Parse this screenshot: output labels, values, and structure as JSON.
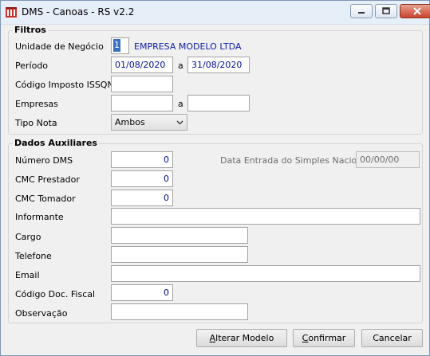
{
  "window": {
    "title": "DMS - Canoas - RS v2.2"
  },
  "filtros": {
    "legend": "Filtros",
    "unidade_label": "Unidade de Negócio",
    "unidade_value": "1",
    "unidade_name": "EMPRESA MODELO LTDA",
    "periodo_label": "Período",
    "periodo_from": "01/08/2020",
    "periodo_sep": "a",
    "periodo_to": "31/08/2020",
    "codigo_label": "Código Imposto ISSQN",
    "codigo_value": "",
    "empresas_label": "Empresas",
    "empresas_from": "",
    "empresas_sep": "a",
    "empresas_to": "",
    "tipo_label": "Tipo Nota",
    "tipo_value": "Ambos"
  },
  "auxiliares": {
    "legend": "Dados Auxiliares",
    "numero_label": "Número DMS",
    "numero_value": "0",
    "data_entrada_label": "Data Entrada do Simples Nacional",
    "data_entrada_value": "00/00/00",
    "cmc_prestador_label": "CMC Prestador",
    "cmc_prestador_value": "0",
    "cmc_tomador_label": "CMC Tomador",
    "cmc_tomador_value": "0",
    "informante_label": "Informante",
    "informante_value": "",
    "cargo_label": "Cargo",
    "cargo_value": "",
    "telefone_label": "Telefone",
    "telefone_value": "",
    "email_label": "Email",
    "email_value": "",
    "codigo_doc_label": "Código Doc. Fiscal",
    "codigo_doc_value": "0",
    "observacao_label": "Observação",
    "observacao_value": ""
  },
  "buttons": {
    "alterar_first": "A",
    "alterar_rest": "lterar Modelo",
    "confirmar_first": "C",
    "confirmar_rest": "onfirmar",
    "cancelar": "Cancelar"
  },
  "colors": {
    "accent_value": "#000c96",
    "company": "#0b1ea3"
  }
}
